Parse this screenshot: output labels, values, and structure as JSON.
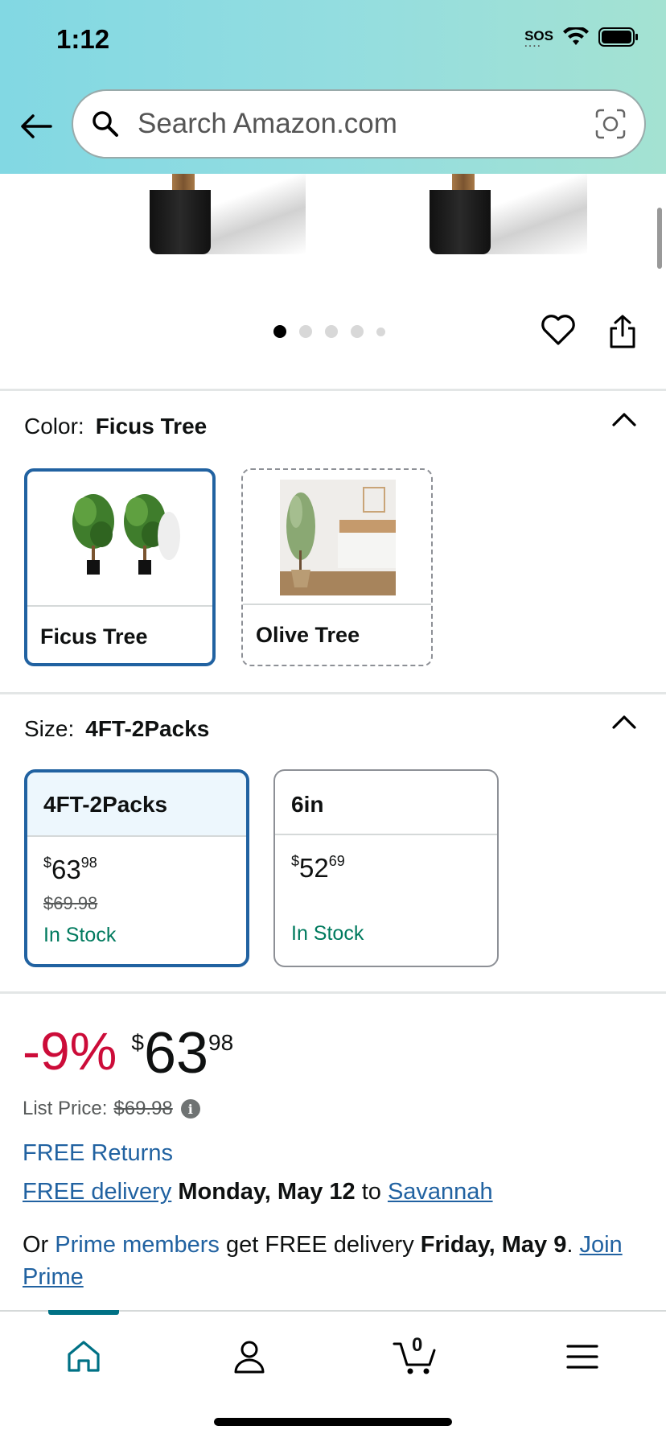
{
  "status_bar": {
    "time": "1:12",
    "sos": "SOS"
  },
  "search": {
    "placeholder": "Search Amazon.com"
  },
  "carousel": {
    "total_images": 5,
    "active_index": 0
  },
  "color": {
    "label": "Color:",
    "selected": "Ficus Tree",
    "options": [
      {
        "label": "Ficus Tree",
        "selected": true
      },
      {
        "label": "Olive Tree",
        "selected": false
      }
    ]
  },
  "size": {
    "label": "Size:",
    "selected": "4FT-2Packs",
    "options": [
      {
        "label": "4FT-2Packs",
        "price_symbol": "$",
        "price_whole": "63",
        "price_fraction": "98",
        "old_price": "$69.98",
        "stock": "In Stock",
        "selected": true
      },
      {
        "label": "6in",
        "price_symbol": "$",
        "price_whole": "52",
        "price_fraction": "69",
        "old_price": "",
        "stock": "In Stock",
        "selected": false
      }
    ]
  },
  "price": {
    "discount": "-9%",
    "symbol": "$",
    "whole": "63",
    "fraction": "98",
    "list_price_label": "List Price:",
    "list_price": "$69.98"
  },
  "returns": "FREE Returns",
  "delivery": {
    "free_label": "FREE delivery",
    "date": "Monday, May 12",
    "to": "to",
    "location": "Savannah"
  },
  "prime": {
    "prefix": "Or",
    "members_link": "Prime members",
    "mid": "get FREE delivery",
    "date": "Friday, May 9",
    "period": ".",
    "join_link_1": "Join",
    "join_link_2": "Prime"
  },
  "bottom_nav": {
    "cart_count": "0",
    "active": "home"
  },
  "colors": {
    "accent_blue": "#2162a1",
    "deal_red": "#cc0c39",
    "stock_green": "#007a5e",
    "nav_teal": "#007185"
  }
}
